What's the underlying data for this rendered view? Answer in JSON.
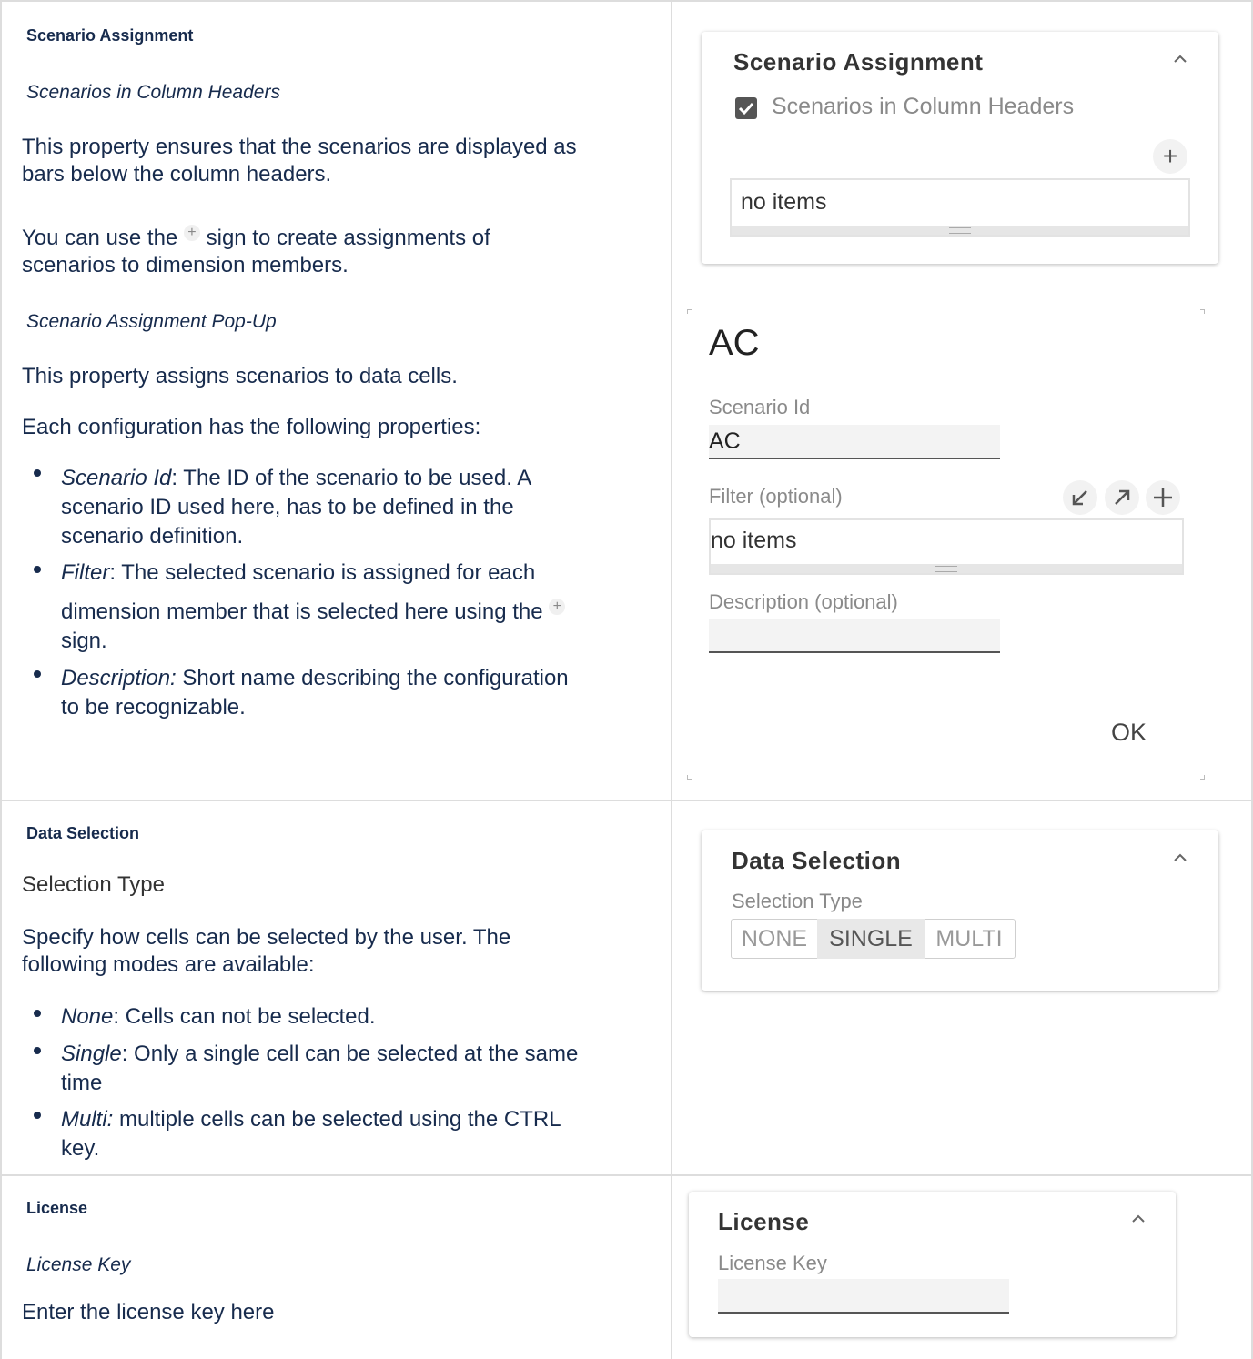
{
  "rows": {
    "scenario": {
      "heading": "Scenario Assignment",
      "sub1": "Scenarios in Column Headers",
      "p1_l1": "This property ensures that the scenarios are displayed as",
      "p1_l2": "bars below the column headers.",
      "p2_a": "You can use the",
      "p2_b": "sign to create assignments of",
      "p2_l2": "scenarios to dimension members.",
      "plus_glyph": "+",
      "sub2": "Scenario Assignment Pop-Up",
      "p3": "This property assigns scenarios to data cells.",
      "p4": "Each configuration has the following properties:",
      "b1_term": "Scenario Id",
      "b1_l1": ": The ID of the scenario to be used. A",
      "b1_l2": "scenario ID used here, has to be defined in the",
      "b1_l3": "scenario definition.",
      "b2_term": "Filter",
      "b2_l1": ": The selected scenario is assigned for each",
      "b2_l2": "dimension member that is selected here using the",
      "b2_l3": "sign.",
      "b3_term": "Description:",
      "b3_l1": " Short name describing the configuration",
      "b3_l2": "to be recognizable."
    },
    "data_selection": {
      "heading": "Data Selection",
      "sub1": "Selection Type",
      "p1_l1": "Specify how cells can be selected by the user. The",
      "p1_l2": "following modes are available:",
      "b1_term": "None",
      "b1_l1": ": Cells can not be selected.",
      "b2_term": "Single",
      "b2_l1": ": Only a single cell can be selected at the same",
      "b2_l2": "time",
      "b3_term": "Multi:",
      "b3_l1": " multiple cells can be selected using the CTRL",
      "b3_l2": "key."
    },
    "license": {
      "heading": "License",
      "sub1": "License Key",
      "p1": "Enter the license key here"
    }
  },
  "panels": {
    "scenario_card": {
      "title": "Scenario Assignment",
      "checkbox_label": "Scenarios in Column Headers",
      "checkbox_checked": true,
      "list_empty": "no items",
      "add_icon": "+",
      "collapse_icon": "chevron-up"
    },
    "popup": {
      "title": "AC",
      "scenario_id_label": "Scenario Id",
      "scenario_id_value": "AC",
      "filter_label": "Filter (optional)",
      "filter_empty": "no items",
      "description_label": "Description (optional)",
      "description_value": "",
      "ok_label": "OK",
      "icons": [
        "arrow-down-left",
        "arrow-up-right",
        "plus"
      ]
    },
    "data_selection_card": {
      "title": "Data Selection",
      "label": "Selection Type",
      "options": [
        "NONE",
        "SINGLE",
        "MULTI"
      ],
      "selected": "SINGLE"
    },
    "license_card": {
      "title": "License",
      "label": "License Key",
      "value": ""
    }
  },
  "colors": {
    "text": "#172b4d",
    "border": "#dddddd",
    "muted": "#8a8a8a",
    "selected_bg": "#e8e8e8"
  }
}
